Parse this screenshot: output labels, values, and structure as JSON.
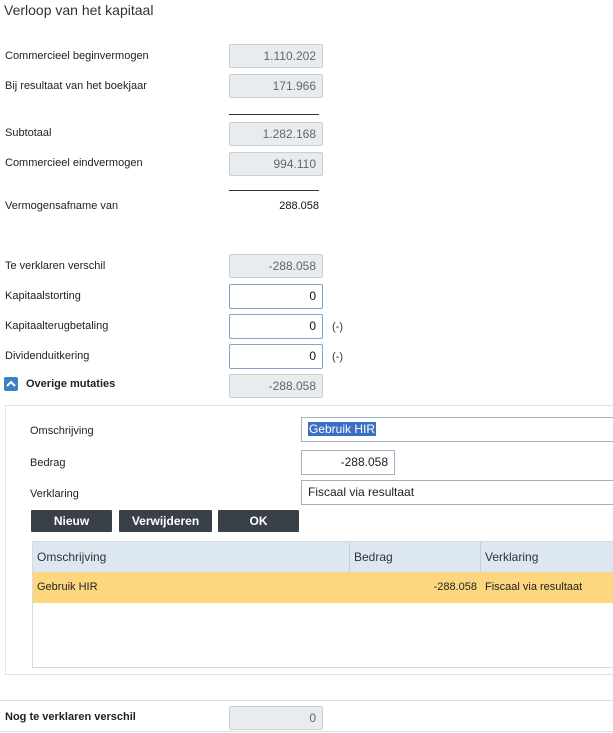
{
  "title": "Verloop van het kapitaal",
  "rows": {
    "beginvermogen": {
      "label": "Commercieel beginvermogen",
      "value": "1.110.202"
    },
    "resultaat": {
      "label": "Bij resultaat van het boekjaar",
      "value": "171.966"
    },
    "subtotaal": {
      "label": "Subtotaal",
      "value": "1.282.168"
    },
    "eindvermogen": {
      "label": "Commercieel eindvermogen",
      "value": "994.110"
    },
    "afname": {
      "label": "Vermogensafname van",
      "value": "288.058"
    },
    "verschil": {
      "label": "Te verklaren verschil",
      "value": "-288.058"
    },
    "kapitaalstorting": {
      "label": "Kapitaalstorting",
      "value": "0"
    },
    "terugbetaling": {
      "label": "Kapitaalterugbetaling",
      "value": "0",
      "suffix": "(-)"
    },
    "dividend": {
      "label": "Dividenduitkering",
      "value": "0",
      "suffix": "(-)"
    },
    "overige": {
      "label": "Overige mutaties",
      "value": "-288.058"
    }
  },
  "form": {
    "omschrijving_label": "Omschrijving",
    "omschrijving_value": "Gebruik HIR",
    "bedrag_label": "Bedrag",
    "bedrag_value": "-288.058",
    "verklaring_label": "Verklaring",
    "verklaring_value": "Fiscaal via resultaat"
  },
  "buttons": {
    "nieuw": "Nieuw",
    "verwijderen": "Verwijderen",
    "ok": "OK"
  },
  "grid": {
    "headers": [
      "Omschrijving",
      "Bedrag",
      "Verklaring"
    ],
    "rows": [
      {
        "omschrijving": "Gebruik HIR",
        "bedrag": "-288.058",
        "verklaring": "Fiscaal via resultaat"
      }
    ]
  },
  "footer": {
    "label": "Nog te verklaren verschil",
    "value": "0"
  },
  "colors": {
    "accent": "#3b7fc4",
    "selected_row": "#fcd77f",
    "button": "#3a4048",
    "grid_header": "#dde7f1"
  }
}
